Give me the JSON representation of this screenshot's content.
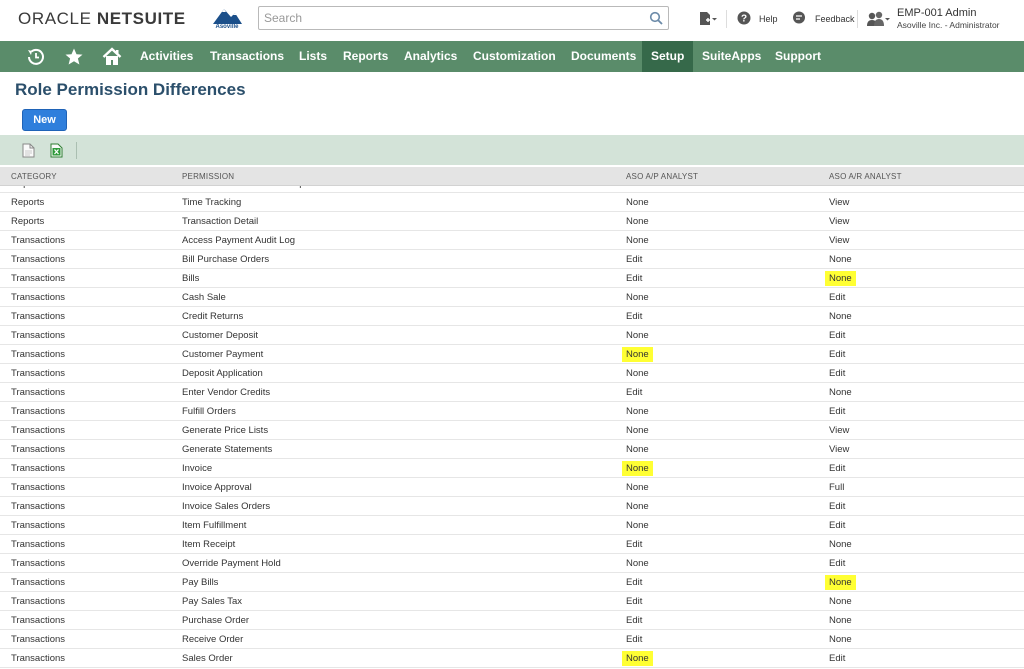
{
  "header": {
    "brand_oracle": "ORACLE",
    "brand_netsuite": "NETSUITE",
    "logo_text": "Asoville",
    "search_placeholder": "Search",
    "help_label": "Help",
    "feedback_label": "Feedback",
    "user_name": "EMP-001 Admin",
    "user_role": "Asoville Inc. - Administrator"
  },
  "nav": {
    "items": [
      {
        "label": "Activities"
      },
      {
        "label": "Transactions"
      },
      {
        "label": "Lists"
      },
      {
        "label": "Reports"
      },
      {
        "label": "Analytics"
      },
      {
        "label": "Customization"
      },
      {
        "label": "Documents"
      },
      {
        "label": "Setup",
        "active": true
      },
      {
        "label": "SuiteApps"
      },
      {
        "label": "Support"
      }
    ]
  },
  "page": {
    "title": "Role Permission Differences",
    "new_button": "New"
  },
  "table": {
    "headers": {
      "category": "CATEGORY",
      "permission": "PERMISSION",
      "ap": "ASO A/P ANALYST",
      "ar": "ASO A/R ANALYST"
    },
    "rows": [
      {
        "category": "Reports",
        "permission": "Sales Order Transaction Report",
        "ap": "View",
        "ar": "None",
        "ap_hl": false,
        "ar_hl": false
      },
      {
        "category": "Reports",
        "permission": "Time Tracking",
        "ap": "None",
        "ar": "View",
        "ap_hl": false,
        "ar_hl": false
      },
      {
        "category": "Reports",
        "permission": "Transaction Detail",
        "ap": "None",
        "ar": "View",
        "ap_hl": false,
        "ar_hl": false
      },
      {
        "category": "Transactions",
        "permission": "Access Payment Audit Log",
        "ap": "None",
        "ar": "View",
        "ap_hl": false,
        "ar_hl": false
      },
      {
        "category": "Transactions",
        "permission": "Bill Purchase Orders",
        "ap": "Edit",
        "ar": "None",
        "ap_hl": false,
        "ar_hl": false
      },
      {
        "category": "Transactions",
        "permission": "Bills",
        "ap": "Edit",
        "ar": "None",
        "ap_hl": false,
        "ar_hl": true
      },
      {
        "category": "Transactions",
        "permission": "Cash Sale",
        "ap": "None",
        "ar": "Edit",
        "ap_hl": false,
        "ar_hl": false
      },
      {
        "category": "Transactions",
        "permission": "Credit Returns",
        "ap": "Edit",
        "ar": "None",
        "ap_hl": false,
        "ar_hl": false
      },
      {
        "category": "Transactions",
        "permission": "Customer Deposit",
        "ap": "None",
        "ar": "Edit",
        "ap_hl": false,
        "ar_hl": false
      },
      {
        "category": "Transactions",
        "permission": "Customer Payment",
        "ap": "None",
        "ar": "Edit",
        "ap_hl": true,
        "ar_hl": false
      },
      {
        "category": "Transactions",
        "permission": "Deposit Application",
        "ap": "None",
        "ar": "Edit",
        "ap_hl": false,
        "ar_hl": false
      },
      {
        "category": "Transactions",
        "permission": "Enter Vendor Credits",
        "ap": "Edit",
        "ar": "None",
        "ap_hl": false,
        "ar_hl": false
      },
      {
        "category": "Transactions",
        "permission": "Fulfill Orders",
        "ap": "None",
        "ar": "Edit",
        "ap_hl": false,
        "ar_hl": false
      },
      {
        "category": "Transactions",
        "permission": "Generate Price Lists",
        "ap": "None",
        "ar": "View",
        "ap_hl": false,
        "ar_hl": false
      },
      {
        "category": "Transactions",
        "permission": "Generate Statements",
        "ap": "None",
        "ar": "View",
        "ap_hl": false,
        "ar_hl": false
      },
      {
        "category": "Transactions",
        "permission": "Invoice",
        "ap": "None",
        "ar": "Edit",
        "ap_hl": true,
        "ar_hl": false
      },
      {
        "category": "Transactions",
        "permission": "Invoice Approval",
        "ap": "None",
        "ar": "Full",
        "ap_hl": false,
        "ar_hl": false
      },
      {
        "category": "Transactions",
        "permission": "Invoice Sales Orders",
        "ap": "None",
        "ar": "Edit",
        "ap_hl": false,
        "ar_hl": false
      },
      {
        "category": "Transactions",
        "permission": "Item Fulfillment",
        "ap": "None",
        "ar": "Edit",
        "ap_hl": false,
        "ar_hl": false
      },
      {
        "category": "Transactions",
        "permission": "Item Receipt",
        "ap": "Edit",
        "ar": "None",
        "ap_hl": false,
        "ar_hl": false
      },
      {
        "category": "Transactions",
        "permission": "Override Payment Hold",
        "ap": "None",
        "ar": "Edit",
        "ap_hl": false,
        "ar_hl": false
      },
      {
        "category": "Transactions",
        "permission": "Pay Bills",
        "ap": "Edit",
        "ar": "None",
        "ap_hl": false,
        "ar_hl": true
      },
      {
        "category": "Transactions",
        "permission": "Pay Sales Tax",
        "ap": "Edit",
        "ar": "None",
        "ap_hl": false,
        "ar_hl": false
      },
      {
        "category": "Transactions",
        "permission": "Purchase Order",
        "ap": "Edit",
        "ar": "None",
        "ap_hl": false,
        "ar_hl": false
      },
      {
        "category": "Transactions",
        "permission": "Receive Order",
        "ap": "Edit",
        "ar": "None",
        "ap_hl": false,
        "ar_hl": false
      },
      {
        "category": "Transactions",
        "permission": "Sales Order",
        "ap": "None",
        "ar": "Edit",
        "ap_hl": true,
        "ar_hl": false
      }
    ]
  },
  "colors": {
    "nav_bg": "#5a8c6a",
    "nav_active": "#36694a",
    "toolbar_bg": "#d3e3d8",
    "highlight": "#ffff33",
    "title": "#2b4f6b",
    "button": "#2f7fdc"
  },
  "icons": [
    "logo-mountain-icon",
    "search-icon",
    "create-new-icon",
    "help-icon",
    "feedback-icon",
    "roles-icon",
    "recent-records-icon",
    "favorites-star-icon",
    "home-icon",
    "print-icon",
    "export-excel-icon"
  ]
}
